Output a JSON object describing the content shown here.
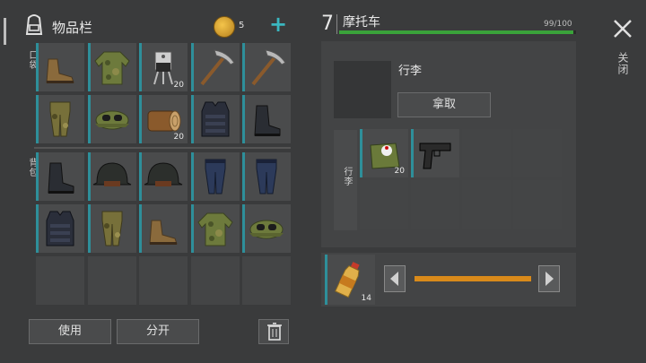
{
  "inventory": {
    "title": "物品栏",
    "coins": "5",
    "add_symbol": "+",
    "pocket_label": "口袋",
    "backpack_label": "背包",
    "pocket_items": [
      {
        "icon": "boots-icon",
        "qty": ""
      },
      {
        "icon": "camo-jacket-icon",
        "qty": ""
      },
      {
        "icon": "transistor-icon",
        "qty": "20"
      },
      {
        "icon": "pickaxe-icon",
        "qty": ""
      },
      {
        "icon": "pickaxe-icon",
        "qty": ""
      },
      {
        "icon": "camo-pants-icon",
        "qty": ""
      },
      {
        "icon": "camo-cap-goggles-icon",
        "qty": ""
      },
      {
        "icon": "wood-log-icon",
        "qty": "20"
      },
      {
        "icon": "body-armor-icon",
        "qty": ""
      },
      {
        "icon": "black-boots-icon",
        "qty": ""
      }
    ],
    "backpack_items": [
      {
        "icon": "black-boots-icon",
        "qty": ""
      },
      {
        "icon": "helmet-icon",
        "qty": ""
      },
      {
        "icon": "helmet-icon",
        "qty": ""
      },
      {
        "icon": "navy-pants-icon",
        "qty": ""
      },
      {
        "icon": "navy-pants-icon",
        "qty": ""
      },
      {
        "icon": "body-armor-icon",
        "qty": ""
      },
      {
        "icon": "camo-pants-icon",
        "qty": ""
      },
      {
        "icon": "boots-icon",
        "qty": ""
      },
      {
        "icon": "camo-jacket-icon",
        "qty": ""
      },
      {
        "icon": "camo-cap-goggles-icon",
        "qty": ""
      }
    ],
    "use_label": "使用",
    "split_label": "分开"
  },
  "vehicle": {
    "level": "7",
    "name": "摩托车",
    "health_text": "99/100",
    "health_fraction": 0.99,
    "health_color": "#3aa33a"
  },
  "trunk": {
    "title": "行李",
    "take_label": "拿取",
    "side_label": "行李",
    "items": [
      {
        "icon": "medkit-bag-icon",
        "qty": "20"
      },
      {
        "icon": "pistol-icon",
        "qty": ""
      }
    ]
  },
  "fuel": {
    "item_icon": "fuel-bottle-icon",
    "qty": "14",
    "level_fraction": 1.0,
    "bar_color": "#d98a1a"
  },
  "close_label": "关闭"
}
